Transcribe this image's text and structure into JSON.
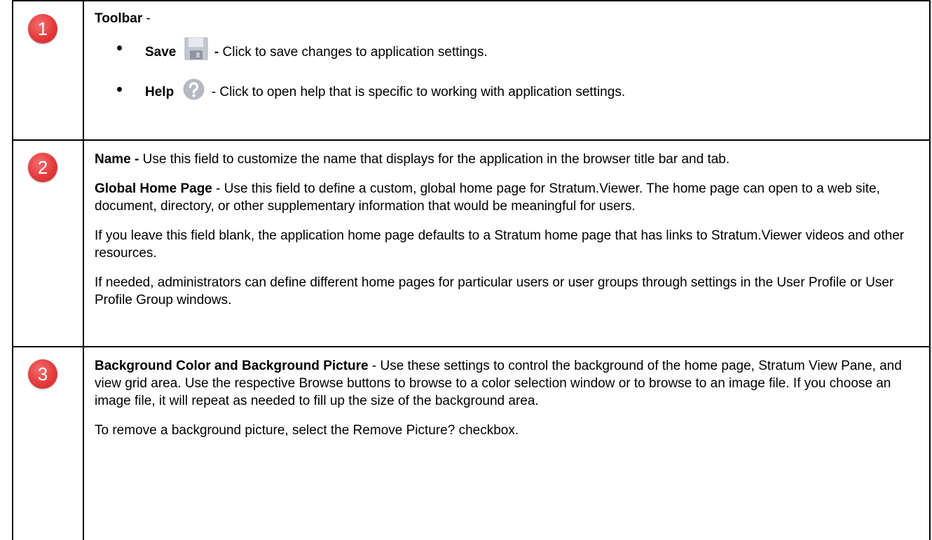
{
  "rows": [
    {
      "badge": "1",
      "title": "Toolbar",
      "title_suffix": " -",
      "items": [
        {
          "label": "Save",
          "icon": "save-icon",
          "separator": " - ",
          "text": "Click to save changes to application settings."
        },
        {
          "label": "Help",
          "icon": "help-icon",
          "separator": " - ",
          "text": "Click to open help that is specific to working with application settings."
        }
      ]
    },
    {
      "badge": "2",
      "paragraphs": [
        {
          "bold": "Name -",
          "text": " Use this field to customize the name that displays for the application in the browser title bar and tab."
        },
        {
          "bold": "Global Home Page",
          "text": " - Use this field to define a custom, global home page for Stratum.Viewer. The home page can open to a web site, document, directory, or other supplementary information that would be meaningful for users."
        },
        {
          "bold": "",
          "text": "If you leave this field blank, the application home page defaults to a Stratum home page that has links to Stratum.Viewer videos and other resources."
        },
        {
          "bold": "",
          "text": "If needed, administrators can define different home pages for particular users or user groups through settings in the User Profile or User Profile Group windows."
        }
      ]
    },
    {
      "badge": "3",
      "paragraphs": [
        {
          "bold": "Background Color and Background Picture",
          "text": " - Use these settings to control the background of the home page, Stratum View Pane, and view grid area. Use the respective Browse buttons to browse to a color selection window or to browse to an image file. If you choose an image file, it will repeat as needed to fill up the size of the background area."
        },
        {
          "bold": "",
          "text": "To remove a background picture, select the Remove Picture? checkbox."
        }
      ]
    }
  ],
  "colors": {
    "badge": "#e43b3b",
    "icon_gray": "#b9bec6"
  }
}
